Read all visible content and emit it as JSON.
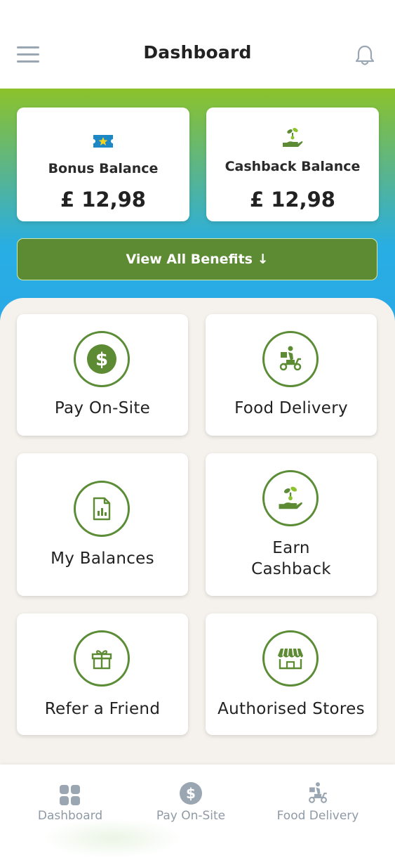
{
  "header": {
    "title": "Dashboard",
    "menu_icon": "hamburger-menu-icon",
    "bell_icon": "bell-icon"
  },
  "balances": [
    {
      "label": "Bonus Balance",
      "amount": "£ 12,98",
      "icon": "ticket-star-icon"
    },
    {
      "label": "Cashback Balance",
      "amount": "£ 12,98",
      "icon": "hand-sprout-icon"
    }
  ],
  "benefits_button": {
    "label": "View All Benefits ↓"
  },
  "tiles": [
    {
      "label": "Pay On-Site",
      "icon": "dollar-circle-icon"
    },
    {
      "label": "Food Delivery",
      "icon": "scooter-delivery-icon"
    },
    {
      "label": "My Balances",
      "icon": "document-chart-icon"
    },
    {
      "label_line1": "Earn",
      "label_line2": "Cashback",
      "icon": "hand-sprout-icon"
    },
    {
      "label": "Refer a Friend",
      "icon": "gift-icon"
    },
    {
      "label": "Authorised Stores",
      "icon": "storefront-icon"
    }
  ],
  "bottom_nav": [
    {
      "label": "Dashboard",
      "icon": "grid-icon"
    },
    {
      "label": "Pay On-Site",
      "icon": "dollar-circle-icon"
    },
    {
      "label": "Food Delivery",
      "icon": "scooter-delivery-icon"
    }
  ],
  "colors": {
    "accent_green": "#5d8b33",
    "icon_gray": "#8f9aa6",
    "gradient_top": "#8cc22a",
    "gradient_bottom": "#2aa9e6"
  }
}
